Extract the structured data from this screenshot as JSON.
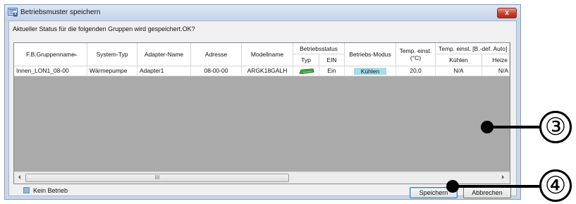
{
  "window": {
    "title": "Betriebsmuster speichern",
    "close_label": "x"
  },
  "message": "Aktueller Status für die folgenden Gruppen wird gespeichert.OK?",
  "table": {
    "headers": {
      "group_name": "F.B.Gruppenname",
      "system_type": "System-Typ",
      "adapter_name": "Adapter-Name",
      "address": "Adresse",
      "model_name": "Modellname",
      "operating_status": "Betriebsstatus",
      "status_type": "Typ",
      "status_on": "EIN",
      "operating_mode": "Betriebs-Modus",
      "temp_setting_line1": "Temp. einst.",
      "temp_setting_line2": "(°C)",
      "temp_setting_auto": "Temp. einst. [B.-def. Auto] (°C)",
      "cooling": "Kühlen",
      "heating": "Heize"
    },
    "rows": [
      {
        "group_name": "Innen_LON1_08-00",
        "system_type": "Wärmepumpe",
        "adapter_name": "Adapter1",
        "address": "08-00-00",
        "model_name": "ARGK18GALH",
        "type_icon": "indoor-unit-icon",
        "on_state": "Ein",
        "operating_mode": "Kühlen",
        "temp_setting": "20,0",
        "cooling_temp": "N/A",
        "heating_temp": "N/A"
      }
    ],
    "scroll_thumb_grip": "III"
  },
  "legend": {
    "label": "Kein Betrieb",
    "color": "#8fb6e6"
  },
  "buttons": {
    "save": "Speichern",
    "cancel": "Abbrechen"
  },
  "callouts": [
    "③",
    "④"
  ],
  "colors": {
    "mode_badge": "#a9dce8",
    "grid_background": "#aaaaaa",
    "close_button": "#c6402b"
  }
}
